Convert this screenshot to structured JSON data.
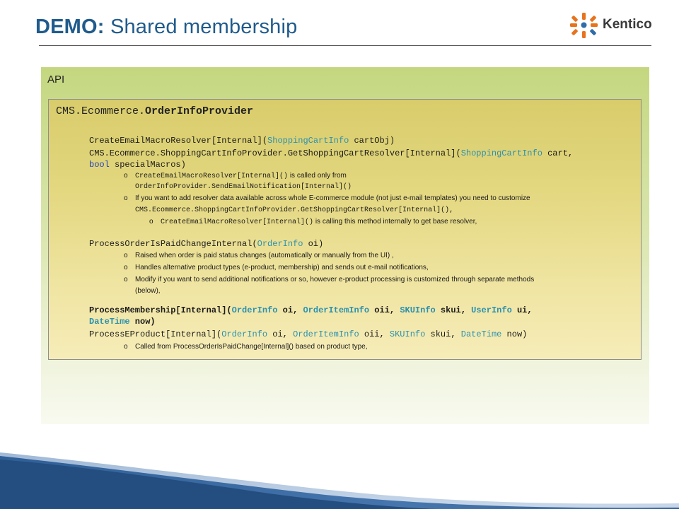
{
  "header": {
    "title_bold": "DEMO:",
    "title_rest": "Shared membership",
    "logo_text": "Kentico"
  },
  "panel": {
    "title": "API"
  },
  "code_box": {
    "title_prefix": "CMS.Ecommerce.",
    "title_class": "OrderInfoProvider",
    "lines": {
      "l1a": "CreateEmailMacroResolver[Internal](",
      "l1b": "ShoppingCartInfo",
      "l1c": " cartObj)",
      "l2a": "CMS.Ecommerce.ShoppingCartInfoProvider.GetShoppingCartResolver[Internal](",
      "l2b": "ShoppingCartInfo",
      "l2c": " cart,",
      "l3a": "bool",
      "l3b": " specialMacros)",
      "b1a": "CreateEmailMacroResolver[Internal]()",
      "b1b": " is called only from",
      "b1c": "OrderInfoProvider.SendEmailNotification[Internal]()",
      "b2": "If you want to add resolver data available across whole E-commerce module (not just e-mail templates) you need to customize",
      "b2c": "CMS.Ecommerce.ShoppingCartInfoProvider.GetShoppingCartResolver[Internal](),",
      "b3a": "CreateEmailMacroResolver[Internal]()",
      "b3b": " is calling this method internally to get base resolver,",
      "l4a": "ProcessOrderIsPaidChangeInternal(",
      "l4b": "OrderInfo",
      "l4c": " oi)",
      "b4": "Raised when order is paid status changes (automatically or manually from the UI) ,",
      "b5": "Handles alternative product types (e-product, membership) and sends out e-mail notifications,",
      "b6": "Modify if you want to send additional notifications or so, however e-product processing is customized through separate methods",
      "b6c": "(below),",
      "l5a": "ProcessMembership[Internal](",
      "l5b": "OrderInfo",
      "l5c": " oi, ",
      "l5d": "OrderItemInfo",
      "l5e": " oii, ",
      "l5f": "SKUInfo",
      "l5g": " skui, ",
      "l5h": "UserInfo",
      "l5i": " ui,",
      "l6a": "DateTime",
      "l6b": " now)",
      "l7a": "ProcessEProduct[Internal](",
      "l7b": "OrderInfo",
      "l7c": " oi, ",
      "l7d": "OrderItemInfo",
      "l7e": " oii, ",
      "l7f": "SKUInfo",
      "l7g": " skui, ",
      "l7h": "DateTime",
      "l7i": " now)",
      "b7": "Called from ProcessOrderIsPaidChange[Internal]() based on product type,"
    },
    "bullet_glyph": "o"
  },
  "colors": {
    "title_blue": "#1f5b8c",
    "type_teal": "#2b91af",
    "keyword_blue": "#1f3fbf",
    "logo_orange": "#e8731c"
  }
}
